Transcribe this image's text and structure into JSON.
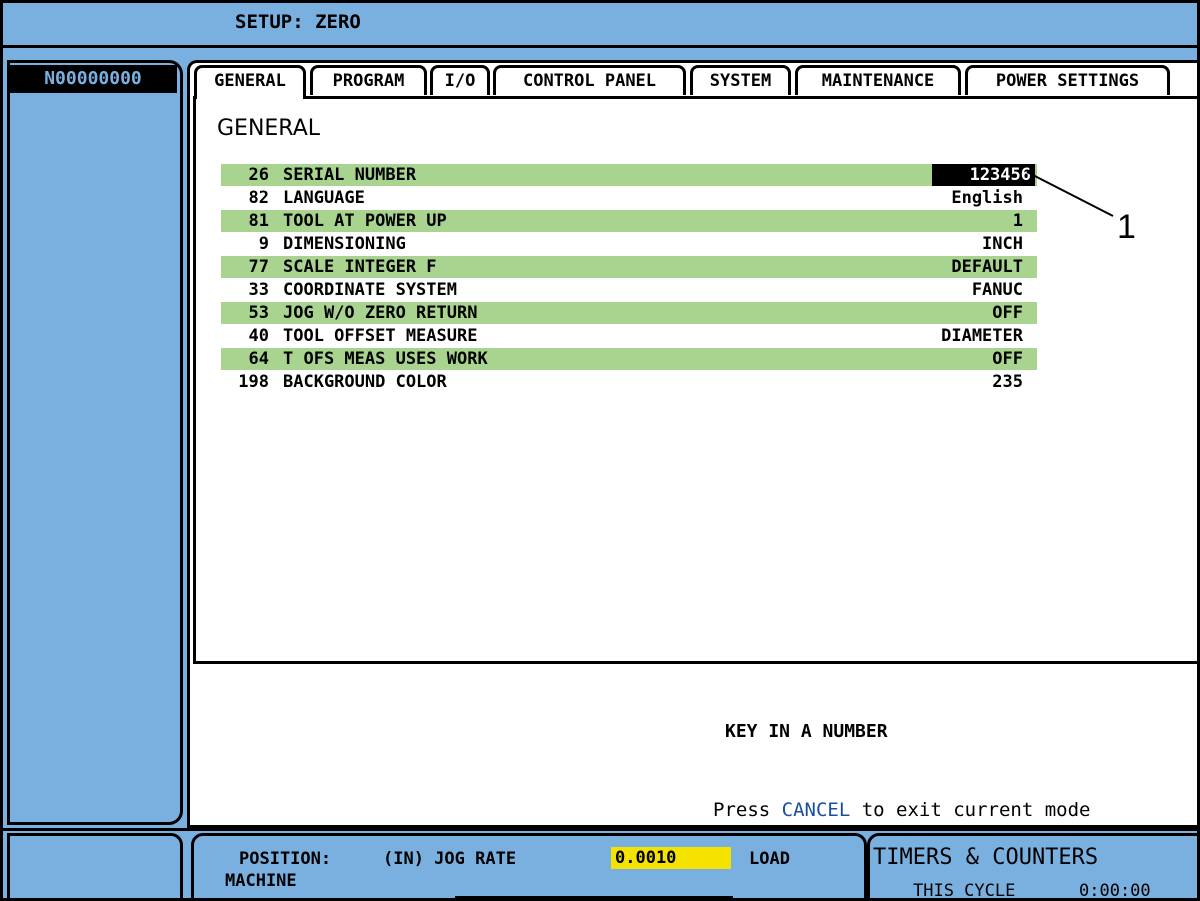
{
  "title": "SETUP: ZERO",
  "program_number": "N00000000",
  "tabs": [
    {
      "label": "GENERAL"
    },
    {
      "label": "PROGRAM"
    },
    {
      "label": "I/O"
    },
    {
      "label": "CONTROL PANEL"
    },
    {
      "label": "SYSTEM"
    },
    {
      "label": "MAINTENANCE"
    },
    {
      "label": "POWER SETTINGS"
    }
  ],
  "active_tab": "GENERAL",
  "section_heading": "GENERAL",
  "settings": [
    {
      "num": "26",
      "label": "SERIAL NUMBER",
      "value": "123456",
      "selected": true
    },
    {
      "num": "82",
      "label": "LANGUAGE",
      "value": "English"
    },
    {
      "num": "81",
      "label": "TOOL AT POWER UP",
      "value": "1"
    },
    {
      "num": "9",
      "label": "DIMENSIONING",
      "value": "INCH"
    },
    {
      "num": "77",
      "label": "SCALE INTEGER F",
      "value": "DEFAULT"
    },
    {
      "num": "33",
      "label": "COORDINATE SYSTEM",
      "value": "FANUC"
    },
    {
      "num": "53",
      "label": "JOG W/O ZERO RETURN",
      "value": "OFF"
    },
    {
      "num": "40",
      "label": "TOOL OFFSET MEASURE",
      "value": "DIAMETER"
    },
    {
      "num": "64",
      "label": "T OFS MEAS USES WORK",
      "value": "OFF"
    },
    {
      "num": "198",
      "label": "BACKGROUND COLOR",
      "value": "235"
    }
  ],
  "callout": "1",
  "prompt": "KEY IN A NUMBER",
  "hint": {
    "prefix": "Press ",
    "key": "CANCEL",
    "suffix": " to exit current mode"
  },
  "bottom": {
    "position_label": "POSITION:",
    "unit_jog_label": "(IN) JOG RATE",
    "jog_rate_value": "0.0010",
    "load_label": "LOAD",
    "machine_label": "MACHINE",
    "timers_title": "TIMERS & COUNTERS",
    "this_cycle_label": "THIS CYCLE",
    "this_cycle_value": "0:00:00"
  },
  "colors": {
    "panel_blue": "#7ab0e0",
    "row_green": "#a8d490",
    "jog_yellow": "#f4e300",
    "cancel_blue": "#1a4fa0"
  }
}
